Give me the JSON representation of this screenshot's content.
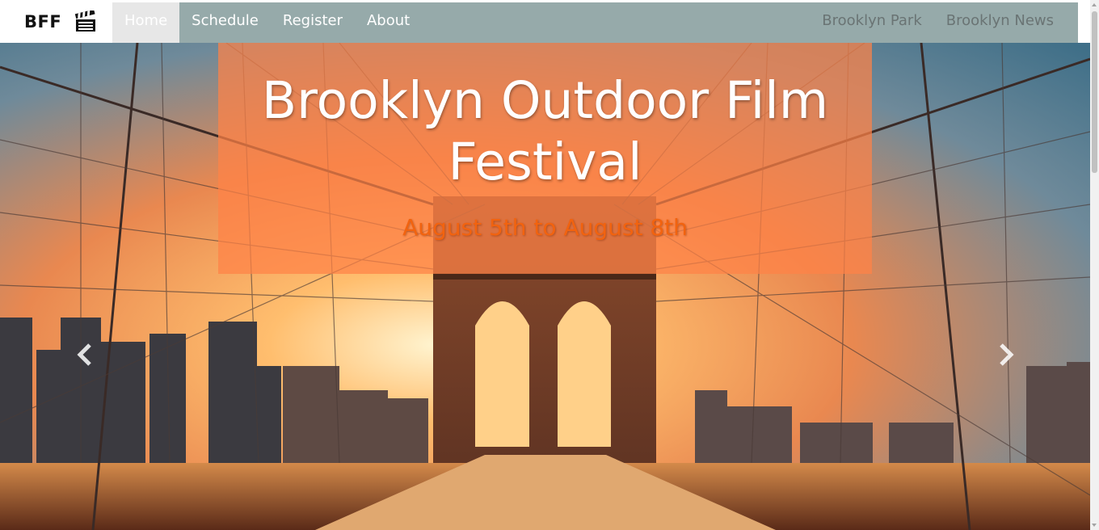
{
  "nav": {
    "brand": "BFF",
    "brand_icon": "clapperboard-icon",
    "left_items": [
      "Home",
      "Schedule",
      "Register",
      "About"
    ],
    "active_item": "Home",
    "right_items": [
      "Brooklyn Park",
      "Brooklyn News"
    ]
  },
  "hero": {
    "title": "Brooklyn Outdoor Film Festival",
    "subtitle": "August 5th to August 8th",
    "prev_icon": "chevron-left-icon",
    "next_icon": "chevron-right-icon",
    "image": "brooklyn-bridge-sunset-photo"
  },
  "colors": {
    "navbar_bg": "#96aaaa",
    "caption_bg": "#ff8246",
    "subtitle_color": "#f2630f",
    "active_nav_bg": "#e7e7e7"
  }
}
